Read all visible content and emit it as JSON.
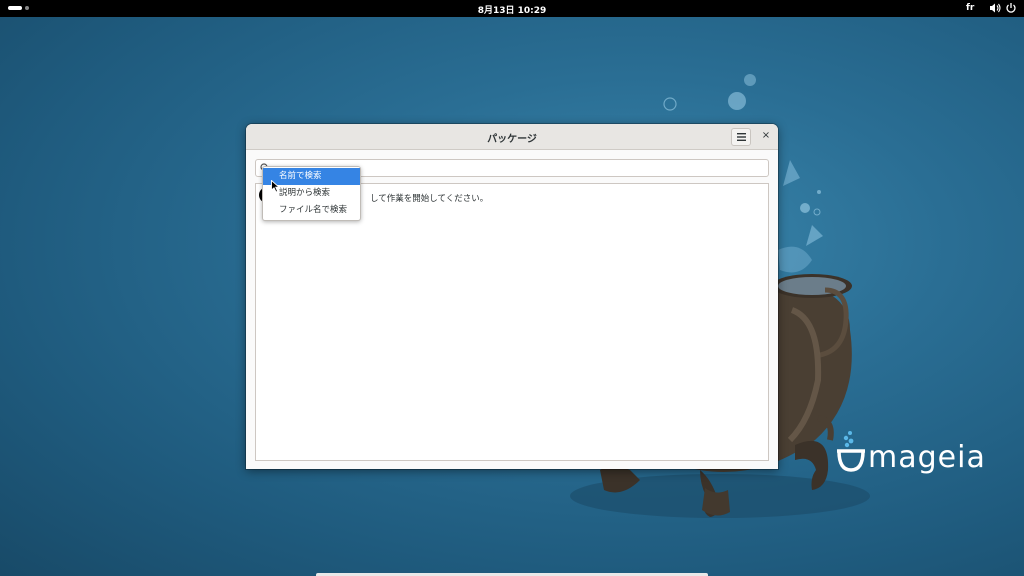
{
  "topbar": {
    "clock": "8月13日  10:29",
    "keyboard_layout": "fr",
    "icons": [
      "activities-icon",
      "volume-icon",
      "power-icon"
    ]
  },
  "window": {
    "title": "パッケージ",
    "menu_icon": "hamburger-menu-icon",
    "close_label": "×",
    "hint_text": "して作業を開始してください。"
  },
  "search": {
    "icon": "search-icon",
    "value": ""
  },
  "popup": {
    "items": [
      {
        "label": "名前で検索",
        "selected": true
      },
      {
        "label": "説明から検索",
        "selected": false
      },
      {
        "label": "ファイル名で検索",
        "selected": false
      }
    ]
  },
  "wallpaper": {
    "brand": "mageia",
    "colors": {
      "background": "#2a6e94",
      "accent": "#3584e4",
      "logo_dots": "#5bb8e8"
    }
  }
}
